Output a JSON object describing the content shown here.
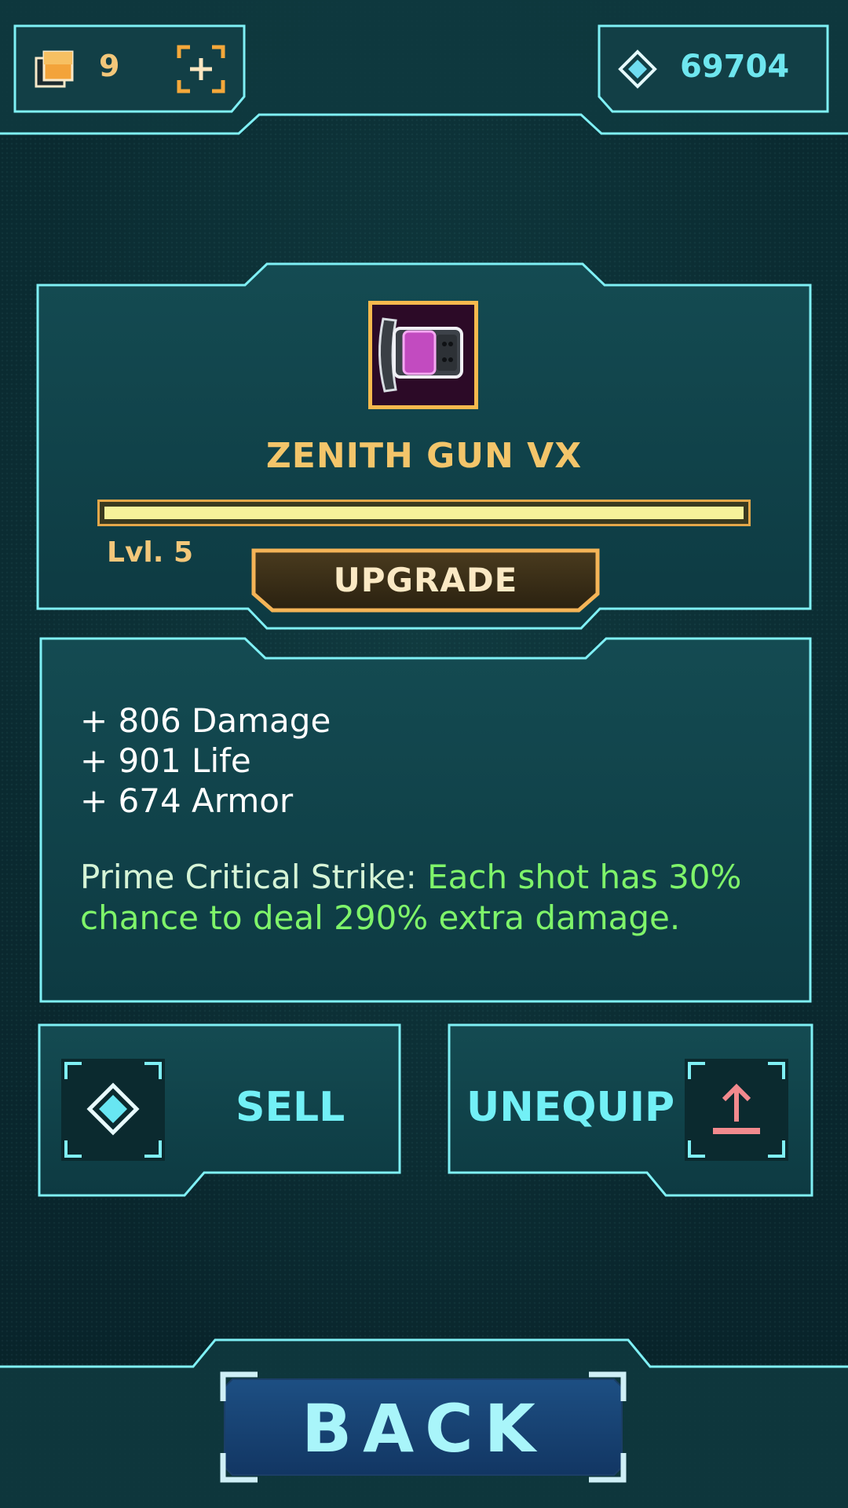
{
  "top_bar": {
    "item_count": "9",
    "gems": "69704"
  },
  "item": {
    "name": "ZENITH GUN VX",
    "level_label": "Lvl. 5",
    "level_progress": 1.0,
    "upgrade_label": "UPGRADE",
    "icon": "pink-gun-icon"
  },
  "stats": {
    "lines": [
      "+ 806 Damage",
      "+ 901 Life",
      "+ 674 Armor"
    ],
    "passive_name": "Prime Critical Strike:",
    "passive_desc_1": "Each shot has 30%",
    "passive_desc_2": "chance to deal 290% extra damage."
  },
  "actions": {
    "sell_label": "SELL",
    "unequip_label": "UNEQUIP"
  },
  "footer": {
    "back_label": "BACK"
  },
  "colors": {
    "accent_cyan": "#7ff0f5",
    "accent_gold": "#f3c56a",
    "accent_green": "#7ff46a",
    "unequip_arrow": "#f28a8e"
  }
}
